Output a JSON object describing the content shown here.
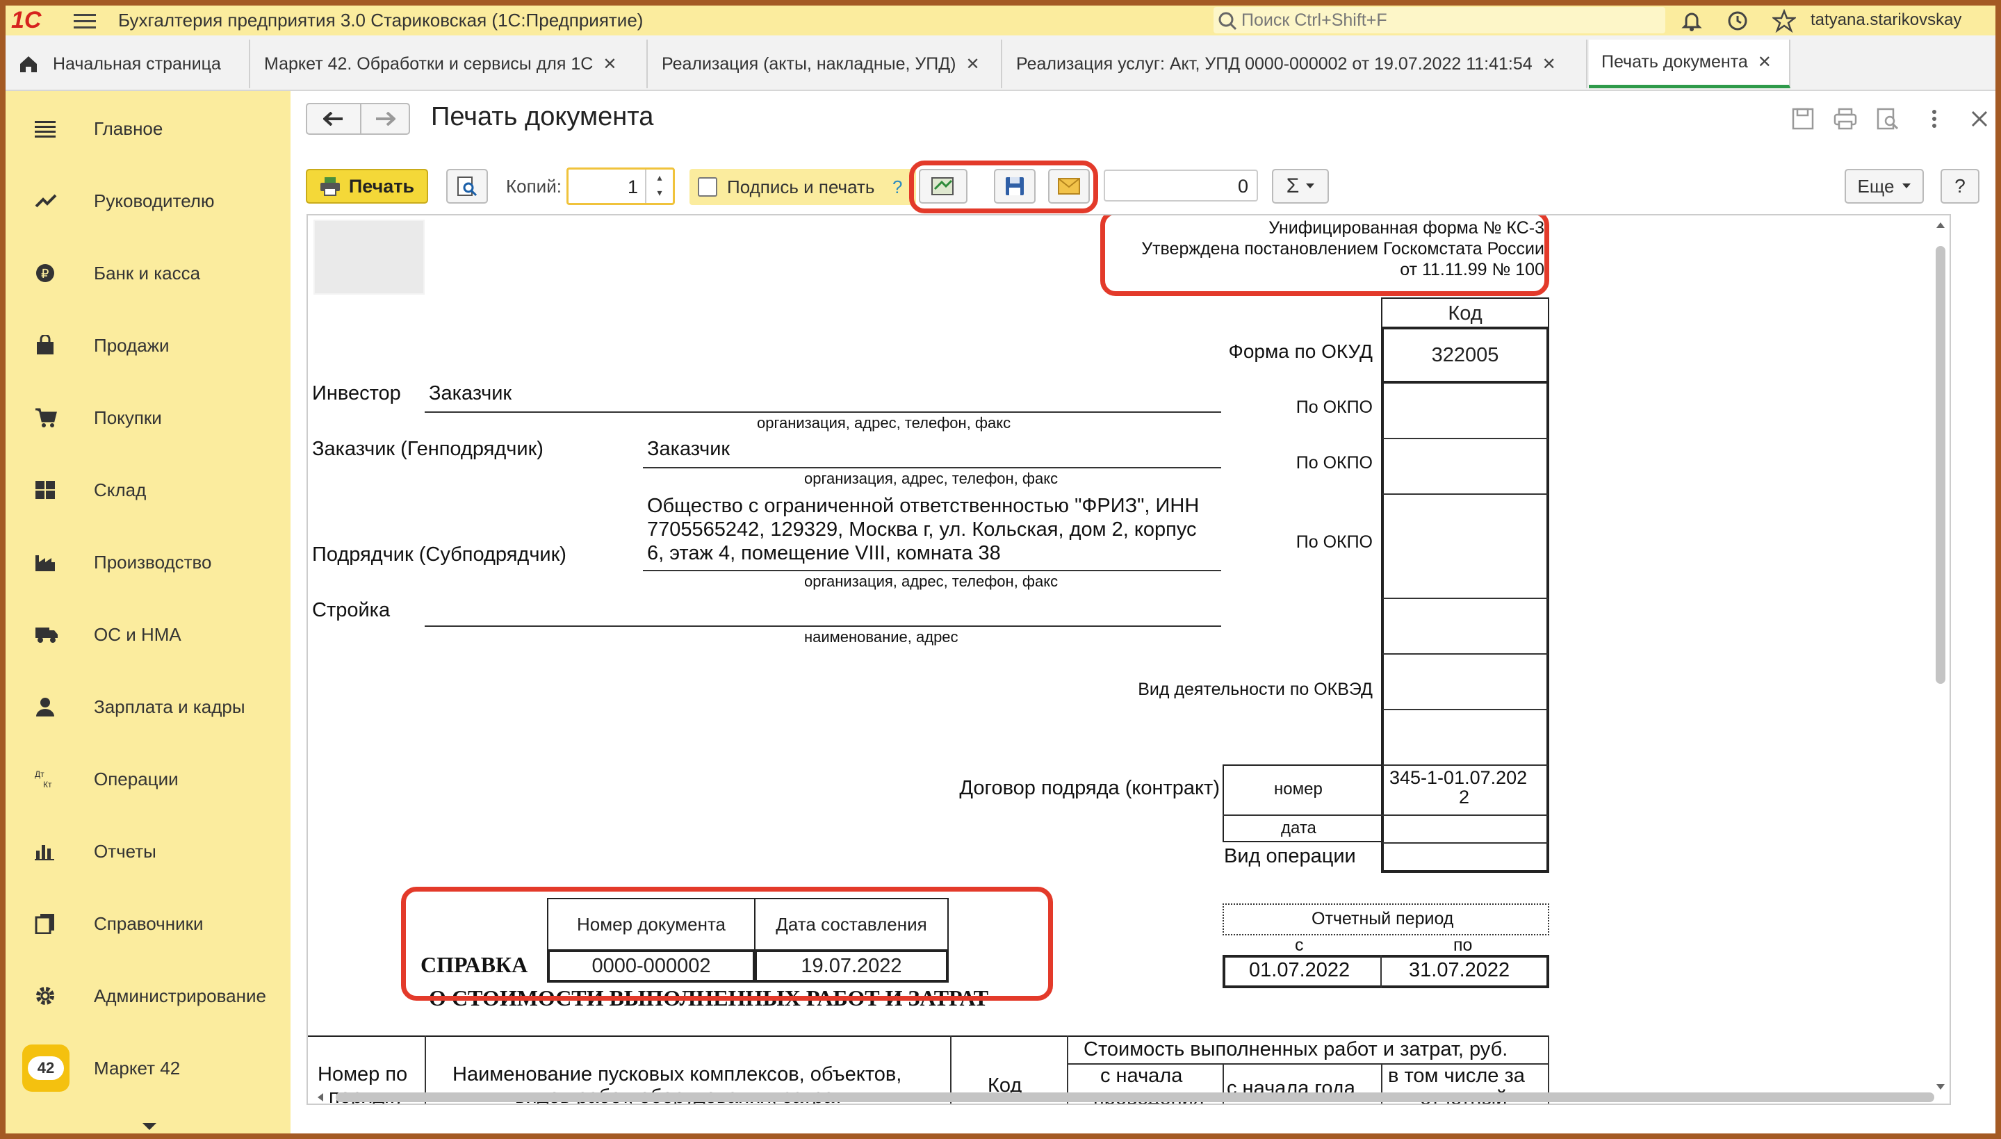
{
  "app": {
    "logo": "1С",
    "title": "Бухгалтерия предприятия 3.0 Стариковская  (1С:Предприятие)",
    "search_placeholder": "Поиск Ctrl+Shift+F",
    "user": "tatyana.starikovskay"
  },
  "tabs": [
    {
      "label": "Начальная страница"
    },
    {
      "label": "Маркет 42. Обработки и сервисы для 1С"
    },
    {
      "label": "Реализация (акты, накладные, УПД)"
    },
    {
      "label": "Реализация услуг: Акт, УПД 0000-000002 от 19.07.2022 11:41:54"
    },
    {
      "label": "Печать документа"
    }
  ],
  "sidebar": {
    "items": [
      {
        "label": "Главное",
        "icon": "menu-icon"
      },
      {
        "label": "Руководителю",
        "icon": "trend-icon"
      },
      {
        "label": "Банк и касса",
        "icon": "coin-icon"
      },
      {
        "label": "Продажи",
        "icon": "bag-icon"
      },
      {
        "label": "Покупки",
        "icon": "cart-icon"
      },
      {
        "label": "Склад",
        "icon": "warehouse-icon"
      },
      {
        "label": "Производство",
        "icon": "factory-icon"
      },
      {
        "label": "ОС и НМА",
        "icon": "truck-icon"
      },
      {
        "label": "Зарплата и кадры",
        "icon": "person-icon"
      },
      {
        "label": "Операции",
        "icon": "dt-kt-icon"
      },
      {
        "label": "Отчеты",
        "icon": "bar-chart-icon"
      },
      {
        "label": "Справочники",
        "icon": "books-icon"
      },
      {
        "label": "Администрирование",
        "icon": "gear-icon"
      },
      {
        "label": "Маркет 42",
        "icon": "market-42-icon",
        "badge": "42"
      }
    ]
  },
  "form": {
    "title": "Печать документа",
    "print_label": "Печать",
    "copies_label": "Копий:",
    "copies_value": "1",
    "sign_label": "Подпись и печать",
    "help_mark": "?",
    "sum_value": "0",
    "sigma": "Σ",
    "more_label": "Еще",
    "help_label": "?"
  },
  "document": {
    "header_lines": [
      "Унифицированная форма № КС-3",
      "Утверждена постановлением  Госкомстата России",
      "от 11.11.99 № 100"
    ],
    "code_header": "Код",
    "okud_label": "Форма по ОКУД",
    "okud_value": "322005",
    "okpo_label": "По ОКПО",
    "investor_label": "Инвестор",
    "investor_value": "Заказчик",
    "org_caption": "организация, адрес, телефон, факс",
    "customer_label": "Заказчик (Генподрядчик)",
    "customer_value": "Заказчик",
    "contractor_label": "Подрядчик (Субподрядчик)",
    "contractor_value": [
      "Общество с ограниченной ответственностью \"ФРИЗ\", ИНН",
      "7705565242, 129329, Москва г, ул. Кольская, дом 2, корпус",
      "6, этаж 4, помещение VIII, комната 38"
    ],
    "site_label": "Стройка",
    "site_caption": "наименование, адрес",
    "okved_label": "Вид деятельности по ОКВЭД",
    "contract_label": "Договор подряда (контракт)",
    "number_label": "номер",
    "contract_number": [
      "345-1-01.07.202",
      "2"
    ],
    "date_label": "дата",
    "operation_label": "Вид операции",
    "period_label": "Отчетный период",
    "period_from_label": "с",
    "period_to_label": "по",
    "period_from": "01.07.2022",
    "period_to": "31.07.2022",
    "doc_number_header": "Номер документа",
    "doc_date_header": "Дата составления",
    "doc_number": "0000-000002",
    "doc_date": "19.07.2022",
    "spravka": "СПРАВКА",
    "spravka_title": "О СТОИМОСТИ ВЫПОЛНЕННЫХ РАБОТ И ЗАТРАТ",
    "table": {
      "col_num": [
        "Номер по",
        "порядку"
      ],
      "col_name": [
        "Наименование пусковых комплексов, объектов,",
        "видов работ, оборудования, затрат"
      ],
      "col_code": "Код",
      "col_cost": "Стоимость выполненных работ и затрат, руб.",
      "col_from_start": [
        "с начала",
        "проведения"
      ],
      "col_from_year": "с начала года",
      "col_incl": [
        "в том числе за",
        "отчетный"
      ]
    }
  },
  "colors": {
    "accent_yellow": "#fbec9e",
    "highlight_red": "#e33a2a",
    "print_button": "#f4d838",
    "active_tab": "#2e9a4a"
  }
}
